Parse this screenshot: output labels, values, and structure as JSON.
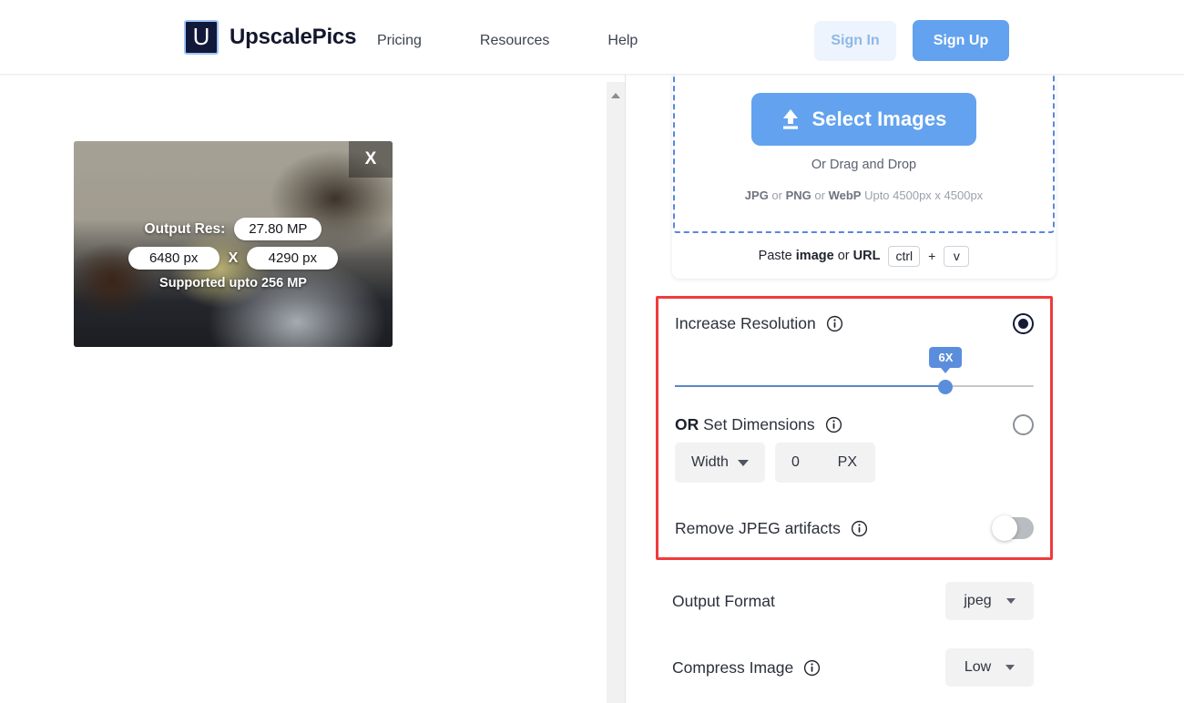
{
  "header": {
    "logo_letter": "U",
    "brand": "UpscalePics",
    "nav": [
      {
        "label": "Pricing"
      },
      {
        "label": "Resources"
      },
      {
        "label": "Help"
      }
    ],
    "sign_in": "Sign In",
    "sign_up": "Sign Up",
    "accent_blue": "#63a2ee",
    "signin_bg": "#eef4fd"
  },
  "preview": {
    "close_label": "X",
    "output_res_label": "Output Res:",
    "megapixels": "27.80 MP",
    "width_px": "6480 px",
    "x_separator": "X",
    "height_px": "4290 px",
    "supported_note": "Supported upto 256 MP"
  },
  "upload": {
    "select_button": "Select Images",
    "upload_icon": "upload-arrow-icon",
    "drag_text": "Or Drag and Drop",
    "formats_jpg": "JPG",
    "formats_or1": " or ",
    "formats_png": "PNG",
    "formats_or2": " or ",
    "formats_webp": "WebP",
    "formats_limit": " Upto 4500px x 4500px",
    "paste_prefix": "Paste ",
    "paste_image": "image",
    "paste_mid": " or ",
    "paste_url": "URL",
    "key_ctrl": "ctrl",
    "key_plus": "+",
    "key_v": "v",
    "dashed_border_color": "#5b86df"
  },
  "settings": {
    "highlight_color": "#ef3b3b",
    "increase_resolution": {
      "label": "Increase Resolution",
      "info_icon": "info-icon",
      "selected": true,
      "slider_value": "6X",
      "slider_percent": 75.5
    },
    "set_dimensions": {
      "label_bold": "OR",
      "label_rest": " Set Dimensions",
      "info_icon": "info-icon",
      "selected": false,
      "dimension_mode": "Width",
      "dimension_value": "0",
      "dimension_unit": "PX"
    },
    "remove_jpeg": {
      "label": "Remove JPEG artifacts",
      "info_icon": "info-icon",
      "enabled": false
    },
    "output_format": {
      "label": "Output Format",
      "value": "jpeg"
    },
    "compress_image": {
      "label": "Compress Image",
      "info_icon": "info-icon",
      "value": "Low"
    }
  },
  "scrollbar": {
    "up_arrow_icon": "scroll-up-arrow-icon"
  }
}
